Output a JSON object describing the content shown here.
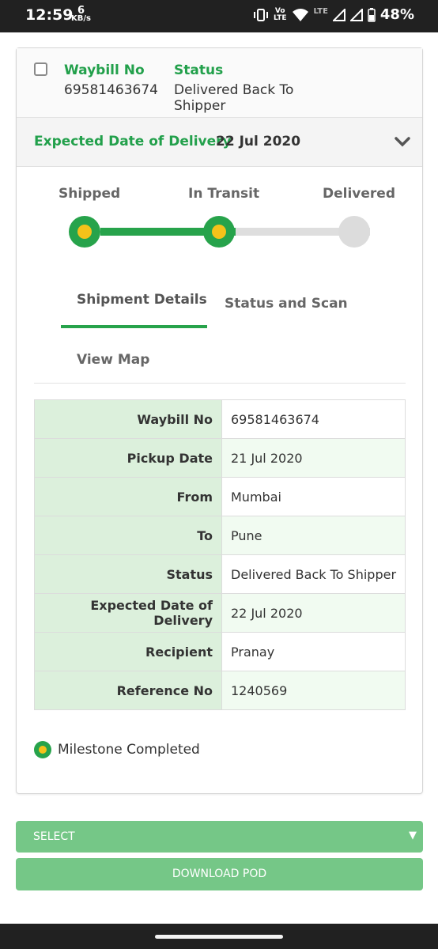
{
  "status_bar": {
    "time": "12:59",
    "net_speed_value": "6",
    "net_speed_unit": "KB/s",
    "volte_top": "Vo",
    "volte_bottom": "LTE",
    "lte": "LTE",
    "battery": "48%"
  },
  "shipment": {
    "header": {
      "waybill_label": "Waybill No",
      "waybill_value": "69581463674",
      "status_label": "Status",
      "status_value": "Delivered Back To Shipper"
    },
    "expected": {
      "label": "Expected Date of Delivery",
      "value": "22 Jul 2020"
    },
    "progress": {
      "steps": [
        {
          "label": "Shipped",
          "state": "completed"
        },
        {
          "label": "In Transit",
          "state": "completed"
        },
        {
          "label": "Delivered",
          "state": "pending"
        }
      ],
      "completed_color": "#27a34b",
      "milestone_color": "#f5c21a",
      "pending_color": "#dcdcdc"
    },
    "tabs": [
      {
        "label": "Shipment Details",
        "active": true
      },
      {
        "label": "Status and Scan",
        "active": false
      },
      {
        "label": "View Map",
        "active": false
      }
    ],
    "details": [
      {
        "key": "Waybill No",
        "value": "69581463674"
      },
      {
        "key": "Pickup Date",
        "value": "21 Jul 2020"
      },
      {
        "key": "From",
        "value": "Mumbai"
      },
      {
        "key": "To",
        "value": "Pune"
      },
      {
        "key": "Status",
        "value": "Delivered Back To Shipper"
      },
      {
        "key": "Expected Date of Delivery",
        "value": "22 Jul 2020"
      },
      {
        "key": "Recipient",
        "value": "Pranay"
      },
      {
        "key": "Reference No",
        "value": "1240569"
      }
    ],
    "legend": "Milestone Completed"
  },
  "actions": {
    "select_label": "SELECT",
    "download_label": "DOWNLOAD POD"
  },
  "colors": {
    "accent_green": "#22a04b",
    "button_green": "#75c787"
  }
}
